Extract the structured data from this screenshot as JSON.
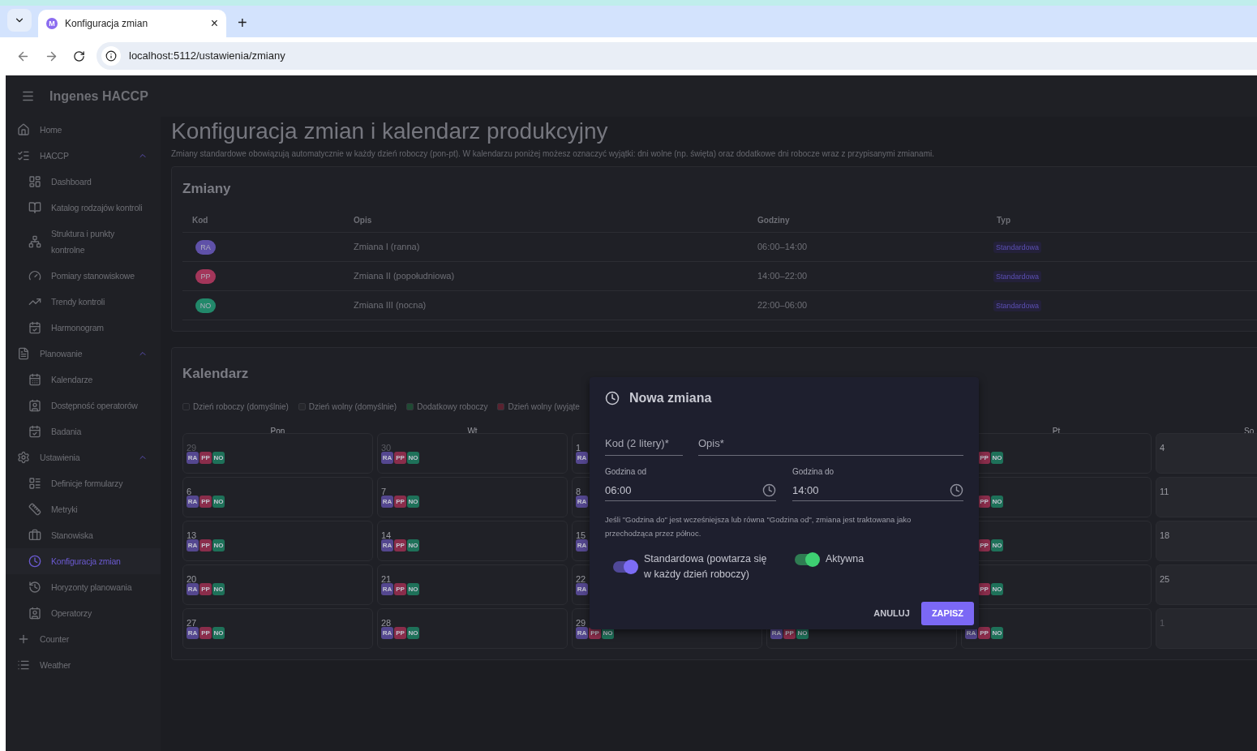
{
  "browser": {
    "tab_title": "Konfiguracja zmian",
    "favicon": "M",
    "close": "×",
    "new_tab": "+",
    "address": "localhost:5112/ustawienia/zmiany"
  },
  "app": {
    "title": "Ingenes HACCP"
  },
  "sidebar": {
    "items": [
      {
        "label": "Home",
        "selected": false
      },
      {
        "label": "HACCP",
        "expanded": true,
        "selected": false,
        "children": [
          {
            "label": "Dashboard",
            "selected": false
          },
          {
            "label": "Katalog rodzajów kontroli",
            "selected": false
          },
          {
            "label": "Struktura i punkty kontrolne",
            "selected": false
          },
          {
            "label": "Pomiary stanowiskowe",
            "selected": false
          },
          {
            "label": "Trendy kontroli",
            "selected": false
          },
          {
            "label": "Harmonogram",
            "selected": false
          }
        ]
      },
      {
        "label": "Planowanie",
        "expanded": true,
        "selected": false,
        "children": [
          {
            "label": "Kalendarze",
            "selected": false
          },
          {
            "label": "Dostępność operatorów",
            "selected": false
          },
          {
            "label": "Badania",
            "selected": false
          }
        ]
      },
      {
        "label": "Ustawienia",
        "expanded": true,
        "selected": false,
        "children": [
          {
            "label": "Definicje formularzy",
            "selected": false
          },
          {
            "label": "Metryki",
            "selected": false
          },
          {
            "label": "Stanowiska",
            "selected": false
          },
          {
            "label": "Konfiguracja zmian",
            "selected": true
          },
          {
            "label": "Horyzonty planowania",
            "selected": false
          },
          {
            "label": "Operatorzy",
            "selected": false
          }
        ]
      },
      {
        "label": "Counter",
        "selected": false
      },
      {
        "label": "Weather",
        "selected": false
      }
    ]
  },
  "page": {
    "title": "Konfiguracja zmian i kalendarz produkcyjny",
    "subtitle": "Zmiany standardowe obowiązują automatycznie w każdy dzień roboczy (pon-pt). W kalendarzu poniżej możesz oznaczyć wyjątki: dni wolne (np. święta) oraz dodatkowe dni robocze wraz z przypisanymi zmianami."
  },
  "shifts": {
    "title": "Zmiany",
    "columns": [
      "Kod",
      "Opis",
      "Godziny",
      "Typ"
    ],
    "rows": [
      {
        "code": "RA",
        "kind": "morning",
        "description": "Zmiana I (ranna)",
        "hours": "06:00–14:00",
        "type": "Standardowa"
      },
      {
        "code": "PP",
        "kind": "afternoon",
        "description": "Zmiana II (popołudniowa)",
        "hours": "14:00–22:00",
        "type": "Standardowa"
      },
      {
        "code": "NO",
        "kind": "night",
        "description": "Zmiana III (nocna)",
        "hours": "22:00–06:00",
        "type": "Standardowa"
      }
    ]
  },
  "calendar": {
    "title": "Kalendarz",
    "legend": [
      {
        "label": "Dzień roboczy (domyślnie)",
        "color": "#202127"
      },
      {
        "label": "Dzień wolny (domyślnie)",
        "color": "#26272c"
      },
      {
        "label": "Dodatkowy roboczy",
        "color": "#1f4a33"
      },
      {
        "label": "Dzień wolny (wyjąte",
        "color": "#5a2230"
      }
    ],
    "weekdays": [
      "Pon",
      "Wt",
      "Pt",
      "So"
    ],
    "weeks": [
      {
        "pon": {
          "number": "29",
          "muted": true,
          "shifts": [
            {
              "code": "RA",
              "kind": "morning"
            },
            {
              "code": "PP",
              "kind": "afternoon"
            },
            {
              "code": "NO",
              "kind": "night"
            }
          ]
        },
        "wt": {
          "number": "30",
          "muted": true,
          "shifts": [
            {
              "code": "RA",
              "kind": "morning"
            },
            {
              "code": "PP",
              "kind": "afternoon"
            },
            {
              "code": "NO",
              "kind": "night"
            }
          ]
        },
        "sr": {
          "number": "1",
          "muted": false,
          "shifts": [
            {
              "code": "RA",
              "kind": "morning"
            }
          ]
        },
        "pt": {
          "shifts": [
            {
              "code": "PP",
              "kind": "afternoon"
            },
            {
              "code": "NO",
              "kind": "night"
            }
          ]
        },
        "sob": {
          "number": "4",
          "muted": false
        }
      },
      {
        "pon": {
          "number": "6",
          "muted": false,
          "shifts": [
            {
              "code": "RA",
              "kind": "morning"
            },
            {
              "code": "PP",
              "kind": "afternoon"
            },
            {
              "code": "NO",
              "kind": "night"
            }
          ]
        },
        "wt": {
          "number": "7",
          "muted": false,
          "shifts": [
            {
              "code": "RA",
              "kind": "morning"
            },
            {
              "code": "PP",
              "kind": "afternoon"
            },
            {
              "code": "NO",
              "kind": "night"
            }
          ]
        },
        "sr": {
          "number": "8",
          "muted": false,
          "shifts": [
            {
              "code": "RA",
              "kind": "morning"
            }
          ]
        },
        "pt": {
          "shifts": [
            {
              "code": "PP",
              "kind": "afternoon"
            },
            {
              "code": "NO",
              "kind": "night"
            }
          ]
        },
        "sob": {
          "number": "11",
          "muted": false
        }
      },
      {
        "pon": {
          "number": "13",
          "muted": false,
          "shifts": [
            {
              "code": "RA",
              "kind": "morning"
            },
            {
              "code": "PP",
              "kind": "afternoon"
            },
            {
              "code": "NO",
              "kind": "night"
            }
          ]
        },
        "wt": {
          "number": "14",
          "muted": false,
          "shifts": [
            {
              "code": "RA",
              "kind": "morning"
            },
            {
              "code": "PP",
              "kind": "afternoon"
            },
            {
              "code": "NO",
              "kind": "night"
            }
          ]
        },
        "sr": {
          "number": "15",
          "muted": false,
          "shifts": [
            {
              "code": "RA",
              "kind": "morning"
            }
          ]
        },
        "pt": {
          "shifts": [
            {
              "code": "PP",
              "kind": "afternoon"
            },
            {
              "code": "NO",
              "kind": "night"
            }
          ]
        },
        "sob": {
          "number": "18",
          "muted": false
        }
      },
      {
        "pon": {
          "number": "20",
          "muted": false,
          "shifts": [
            {
              "code": "RA",
              "kind": "morning"
            },
            {
              "code": "PP",
              "kind": "afternoon"
            },
            {
              "code": "NO",
              "kind": "night"
            }
          ]
        },
        "wt": {
          "number": "21",
          "muted": false,
          "shifts": [
            {
              "code": "RA",
              "kind": "morning"
            },
            {
              "code": "PP",
              "kind": "afternoon"
            },
            {
              "code": "NO",
              "kind": "night"
            }
          ]
        },
        "sr": {
          "number": "22",
          "muted": false,
          "shifts": [
            {
              "code": "RA",
              "kind": "morning"
            }
          ]
        },
        "pt": {
          "shifts": [
            {
              "code": "PP",
              "kind": "afternoon"
            },
            {
              "code": "NO",
              "kind": "night"
            }
          ]
        },
        "sob": {
          "number": "25",
          "muted": false
        }
      },
      {
        "pon": {
          "number": "27",
          "muted": false,
          "shifts": [
            {
              "code": "RA",
              "kind": "morning"
            },
            {
              "code": "PP",
              "kind": "afternoon"
            },
            {
              "code": "NO",
              "kind": "night"
            }
          ]
        },
        "wt": {
          "number": "28",
          "muted": false,
          "shifts": [
            {
              "code": "RA",
              "kind": "morning"
            },
            {
              "code": "PP",
              "kind": "afternoon"
            },
            {
              "code": "NO",
              "kind": "night"
            }
          ]
        },
        "sr": {
          "number": "29",
          "muted": false,
          "shifts": [
            {
              "code": "RA",
              "kind": "morning"
            },
            {
              "code": "PP",
              "kind": "afternoon"
            },
            {
              "code": "NO",
              "kind": "night"
            }
          ]
        },
        "czw": {
          "shifts": [
            {
              "code": "RA",
              "kind": "morning"
            },
            {
              "code": "PP",
              "kind": "afternoon"
            },
            {
              "code": "NO",
              "kind": "night"
            }
          ]
        },
        "pt": {
          "shifts": [
            {
              "code": "RA",
              "kind": "morning"
            },
            {
              "code": "PP",
              "kind": "afternoon"
            },
            {
              "code": "NO",
              "kind": "night"
            }
          ]
        },
        "sob": {
          "number": "1",
          "muted": true
        }
      }
    ]
  },
  "dialog": {
    "title": "Nowa zmiana",
    "fields": [
      {
        "kind": "text",
        "placeholder": "Kod (2 litery)*"
      },
      {
        "kind": "text",
        "placeholder": "Opis*"
      },
      {
        "kind": "time",
        "label": "Godzina od",
        "value": "06:00"
      },
      {
        "kind": "time",
        "label": "Godzina do",
        "value": "14:00"
      }
    ],
    "hint": "Jeśli \"Godzina do\" jest wcześniejsza lub równa \"Godzina od\", zmiana jest traktowana jako przechodząca przez północ.",
    "switches": [
      {
        "label": "Standardowa (powtarza się w każdy dzień roboczy)",
        "on": true,
        "color": "#7c6cf5"
      },
      {
        "label": "Aktywna",
        "on": true,
        "color": "#3ecf72"
      }
    ],
    "buttons": [
      {
        "label": "ANULUJ",
        "kind": "text"
      },
      {
        "label": "ZAPISZ",
        "kind": "primary"
      }
    ]
  }
}
